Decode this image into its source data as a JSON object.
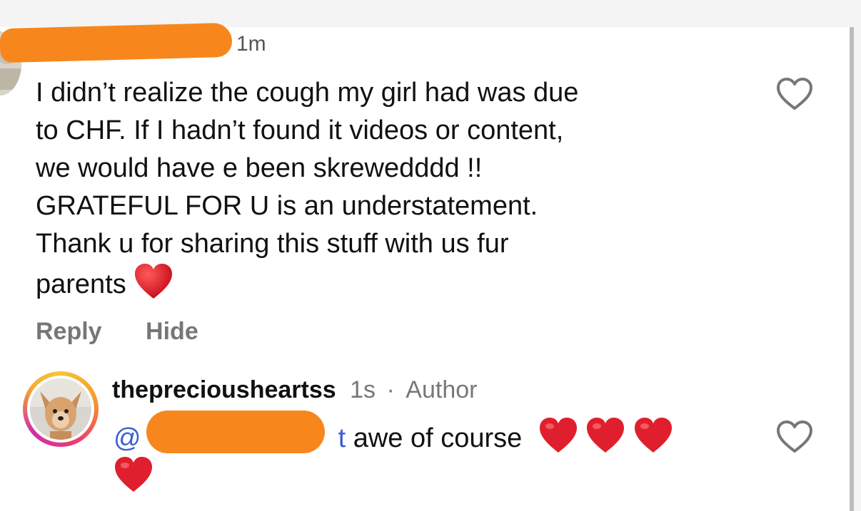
{
  "comment": {
    "time": "1m",
    "lines": [
      "I didn’t realize the cough my girl had was due",
      "to CHF. If I hadn’t found it videos or content,",
      "we would have e been skrewedddd !!",
      "GRATEFUL FOR U is an understatement.",
      "Thank u for sharing this stuff with us fur",
      "parents"
    ],
    "emoji": "heart",
    "actions": {
      "reply": "Reply",
      "hide": "Hide"
    }
  },
  "reply": {
    "username": "thepreciousheartss",
    "time": "1s",
    "separator": "·",
    "role": "Author",
    "mention_start": "@",
    "mention_end": "t",
    "text": "awe of course",
    "emojis": [
      "heart",
      "heart",
      "heart",
      "heart"
    ]
  },
  "colors": {
    "redaction": "#f7871c",
    "mention": "#3b5fd0",
    "heart": "#e8202f",
    "muted": "#777777"
  }
}
